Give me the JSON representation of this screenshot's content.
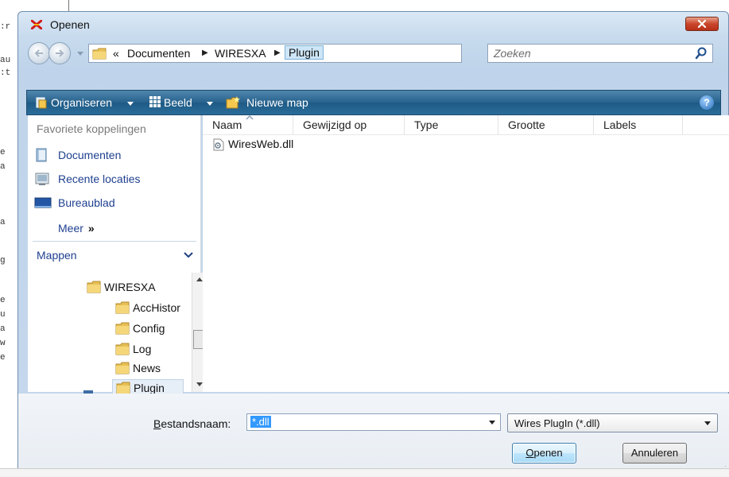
{
  "background": {
    "code_lines": [
      ":r",
      "au",
      ":t",
      "e",
      "a",
      "a",
      "g",
      "e",
      "u",
      "a",
      "w",
      "e",
      "re"
    ]
  },
  "dialog": {
    "title": "Openen",
    "address": {
      "crumbs": [
        "«",
        "Documenten",
        "WIRESXA",
        "Plugin"
      ]
    },
    "search": {
      "placeholder": "Zoeken"
    },
    "toolbar": {
      "organize": "Organiseren",
      "view": "Beeld",
      "new_folder": "Nieuwe map"
    },
    "favorites": {
      "header": "Favoriete koppelingen",
      "items": [
        {
          "label": "Documenten",
          "icon": "documents-icon"
        },
        {
          "label": "Recente locaties",
          "icon": "recent-places-icon"
        },
        {
          "label": "Bureaublad",
          "icon": "desktop-icon"
        }
      ],
      "more": "Meer",
      "more_arrow": "»"
    },
    "folders": {
      "header": "Mappen",
      "tree": [
        {
          "label": "WIRESXA",
          "level": 0
        },
        {
          "label": "AccHistor",
          "level": 1
        },
        {
          "label": "Config",
          "level": 1
        },
        {
          "label": "Log",
          "level": 1
        },
        {
          "label": "News",
          "level": 1
        },
        {
          "label": "Plugin",
          "level": 1,
          "selected": true
        }
      ]
    },
    "columns": [
      "Naam",
      "Gewijzigd op",
      "Type",
      "Grootte",
      "Labels"
    ],
    "files": [
      {
        "name": "WiresWeb.dll",
        "icon": "dll-file-icon"
      }
    ],
    "filename": {
      "label_prefix": "B",
      "label_rest": "estandsnaam:",
      "value": "*.dll"
    },
    "filter": {
      "value": "Wires PlugIn (*.dll)"
    },
    "buttons": {
      "open_prefix": "O",
      "open_rest": "penen",
      "cancel": "Annuleren"
    }
  },
  "colors": {
    "toolbar": "#27628d",
    "link": "#1e3f8f",
    "selection": "#3399ff",
    "close": "#c9462b"
  }
}
